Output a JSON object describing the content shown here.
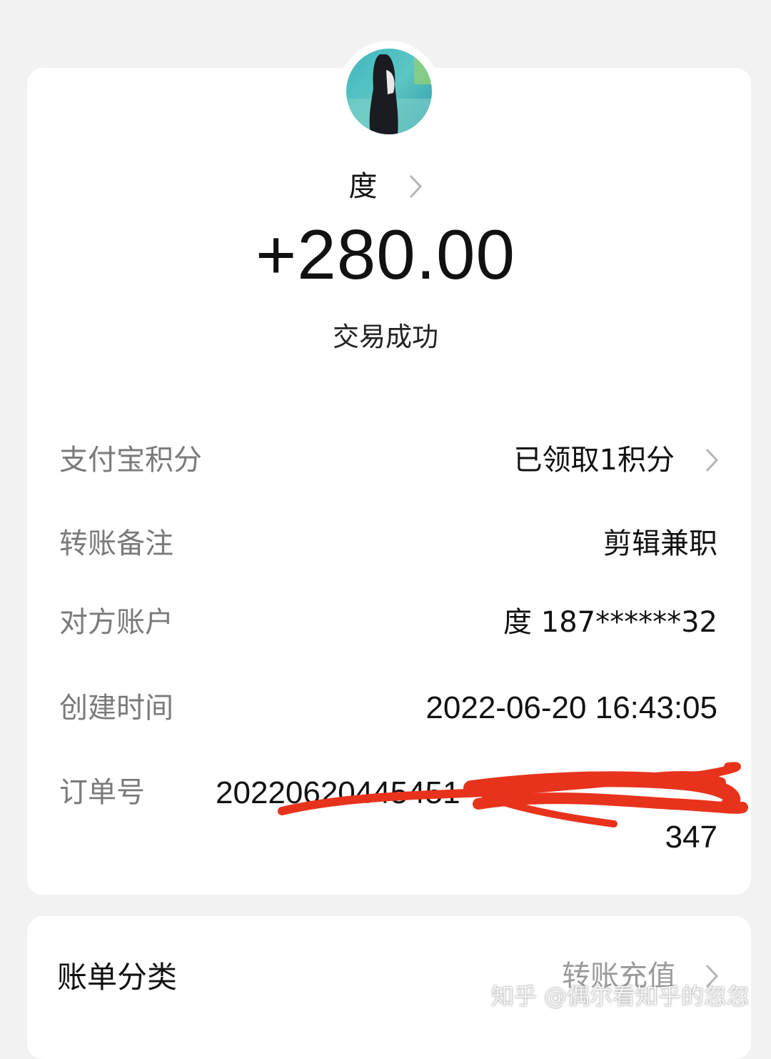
{
  "header": {
    "avatar_icon": "user-avatar-photo",
    "name": "度",
    "amount": "+280.00",
    "status": "交易成功"
  },
  "details": {
    "points": {
      "label": "支付宝积分",
      "value": "已领取1积分"
    },
    "note": {
      "label": "转账备注",
      "value": "剪辑兼职"
    },
    "account": {
      "label": "对方账户",
      "value": "度 187******32"
    },
    "created": {
      "label": "创建时间",
      "value": "2022-06-20 16:43:05"
    },
    "order": {
      "label": "订单号",
      "visible_prefix": "20220620445451",
      "tail": "347"
    }
  },
  "category": {
    "label": "账单分类",
    "value": "转账充值"
  },
  "watermark": "知乎 @偶尔看知乎的忽忽",
  "colors": {
    "label_gray": "#7a7a7a",
    "scribble_red": "#e8331c",
    "background": "#f2f2f2"
  }
}
